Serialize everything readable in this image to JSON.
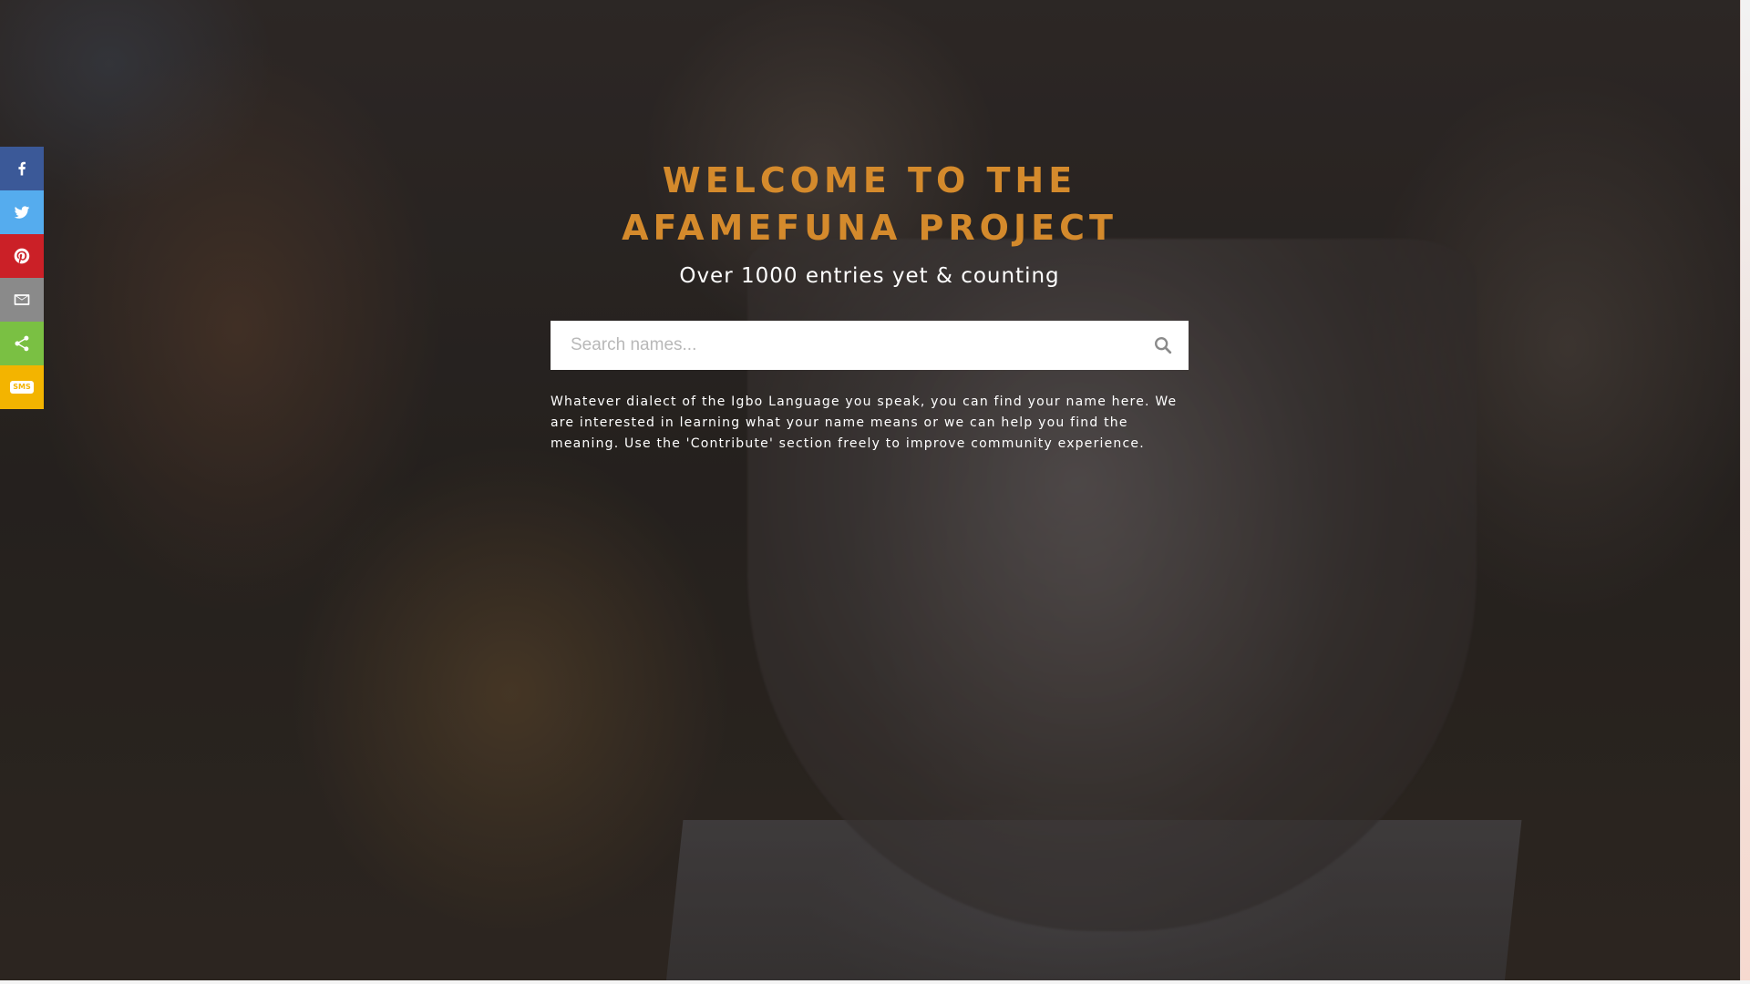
{
  "hero": {
    "title_line1": "WELCOME TO THE",
    "title_line2": "AFAMEFUNA PROJECT",
    "subtitle": "Over 1000 entries yet & counting",
    "description": "Whatever dialect of the Igbo Language you speak, you can find your name here. We are interested in learning what your name means or we can help you find the meaning. Use the 'Contribute' section freely to improve community experience."
  },
  "search": {
    "placeholder": "Search names...",
    "value": "",
    "icon": "search-icon"
  },
  "share_bar": {
    "items": [
      {
        "name": "facebook",
        "icon": "facebook-icon",
        "color": "#3b5998"
      },
      {
        "name": "twitter",
        "icon": "twitter-icon",
        "color": "#55acee"
      },
      {
        "name": "pinterest",
        "icon": "pinterest-icon",
        "color": "#cb2027"
      },
      {
        "name": "email",
        "icon": "email-icon",
        "color": "#8a8a8a"
      },
      {
        "name": "share",
        "icon": "share-icon",
        "color": "#7ac043"
      },
      {
        "name": "sms",
        "icon": "sms-icon",
        "label": "SMS",
        "color": "#f3b400"
      }
    ]
  },
  "colors": {
    "title": "#d48a2c",
    "text": "#ffffff"
  }
}
